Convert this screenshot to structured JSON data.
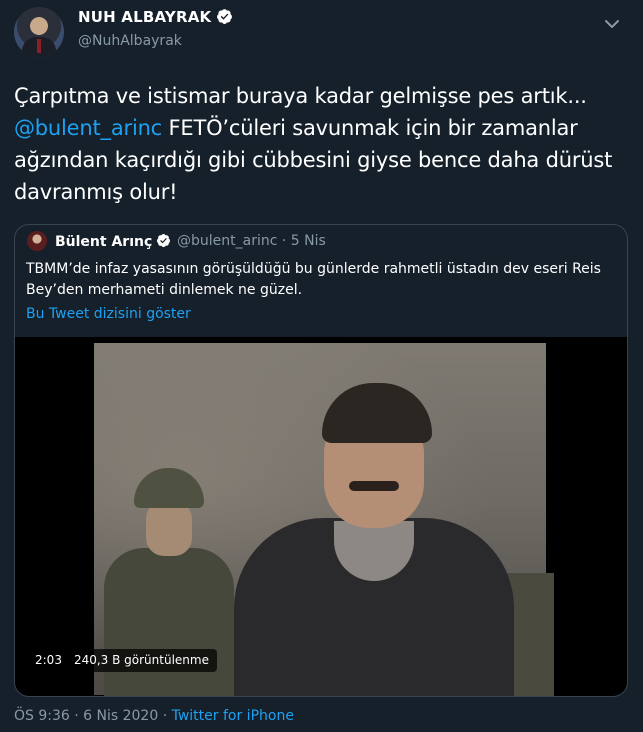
{
  "author": {
    "display_name": "NUH ALBAYRAK",
    "handle": "@NuhAlbayrak",
    "verified": true
  },
  "tweet": {
    "text_before_mention": "Çarpıtma ve istismar buraya kadar gelmişse pes artık... ",
    "mention": "@bulent_arinc",
    "text_after_mention": " FETÖ’cüleri savunmak için bir zamanlar ağzından kaçırdığı gibi cübbesini giyse bence daha dürüst davranmış olur!"
  },
  "quoted_tweet": {
    "display_name": "Bülent Arınç",
    "handle": "@bulent_arinc",
    "separator": "·",
    "date": "5 Nis",
    "text": "TBMM’de infaz yasasının görüşüldüğü bu günlerde rahmetli üstadın dev eseri Reis Bey’den merhameti dinlemek ne güzel.",
    "thread_link": "Bu Tweet dizisini göster",
    "video": {
      "duration": "2:03",
      "views": "240,3 B görüntülenme"
    }
  },
  "footer": {
    "time": "ÖS 9:36",
    "separator": "·",
    "date": "6 Nis 2020",
    "source": "Twitter for iPhone"
  },
  "colors": {
    "background": "#15202b",
    "accent": "#1da1f2",
    "secondary_text": "#8899a6",
    "border": "#38444d"
  },
  "icons": [
    "verified-badge-icon",
    "chevron-down-icon"
  ]
}
